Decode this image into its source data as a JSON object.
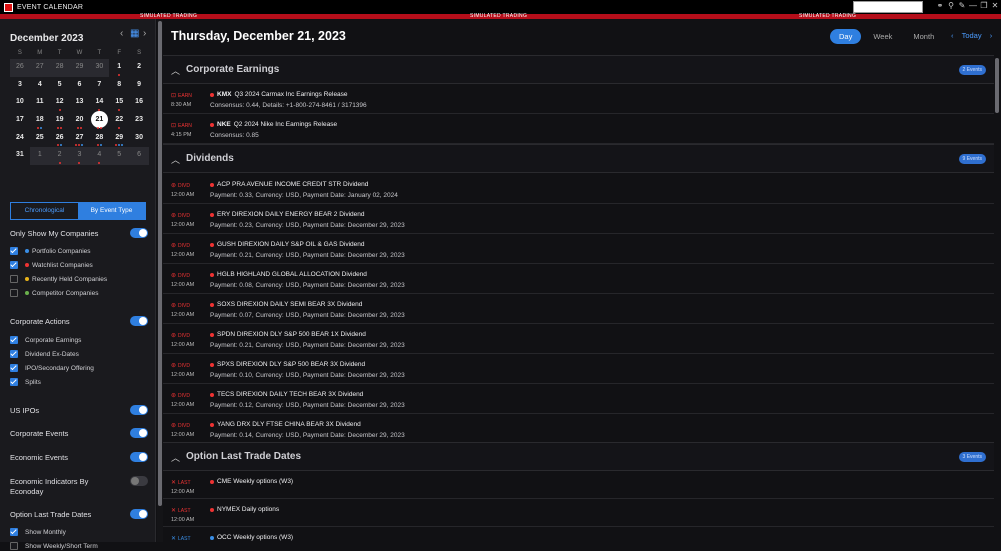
{
  "window": {
    "title": "EVENT CALENDAR",
    "banner": "SIMULATED TRADING",
    "controls": [
      "⚭",
      "⚲",
      "✎",
      "—",
      "❐",
      "✕"
    ]
  },
  "calendar": {
    "month_label": "December 2023",
    "prev": "‹",
    "next": "›",
    "cal_icon": "▦",
    "dow": [
      "S",
      "M",
      "T",
      "W",
      "T",
      "F",
      "S"
    ],
    "weeks": [
      [
        [
          "26",
          "o",
          ""
        ],
        [
          "27",
          "o",
          ""
        ],
        [
          "28",
          "o",
          ""
        ],
        [
          "29",
          "o",
          ""
        ],
        [
          "30",
          "o",
          ""
        ],
        [
          "1",
          "c",
          "r"
        ],
        [
          "2",
          "c",
          ""
        ]
      ],
      [
        [
          "3",
          "c",
          ""
        ],
        [
          "4",
          "c",
          ""
        ],
        [
          "5",
          "c",
          ""
        ],
        [
          "6",
          "c",
          ""
        ],
        [
          "7",
          "c",
          ""
        ],
        [
          "8",
          "c",
          ""
        ],
        [
          "9",
          "c",
          ""
        ]
      ],
      [
        [
          "10",
          "c",
          ""
        ],
        [
          "11",
          "c",
          ""
        ],
        [
          "12",
          "c",
          "r"
        ],
        [
          "13",
          "c",
          ""
        ],
        [
          "14",
          "c",
          "r"
        ],
        [
          "15",
          "c",
          "r"
        ],
        [
          "16",
          "c",
          ""
        ]
      ],
      [
        [
          "17",
          "c",
          ""
        ],
        [
          "18",
          "c",
          "rb"
        ],
        [
          "19",
          "c",
          "rr"
        ],
        [
          "20",
          "c",
          "rr"
        ],
        [
          "21",
          "s",
          "rr"
        ],
        [
          "22",
          "c",
          "r"
        ],
        [
          "23",
          "c",
          ""
        ]
      ],
      [
        [
          "24",
          "c",
          ""
        ],
        [
          "25",
          "c",
          ""
        ],
        [
          "26",
          "c",
          "rb"
        ],
        [
          "27",
          "c",
          "rrb"
        ],
        [
          "28",
          "c",
          "rb"
        ],
        [
          "29",
          "c",
          "rbb"
        ],
        [
          "30",
          "c",
          ""
        ]
      ],
      [
        [
          "31",
          "c",
          ""
        ],
        [
          "1",
          "o",
          ""
        ],
        [
          "2",
          "o",
          "r"
        ],
        [
          "3",
          "o",
          "r"
        ],
        [
          "4",
          "o",
          "r"
        ],
        [
          "5",
          "o",
          ""
        ],
        [
          "6",
          "o",
          ""
        ]
      ]
    ]
  },
  "segment": {
    "chronological": "Chronological",
    "by_type": "By Event Type"
  },
  "filters": {
    "only_mine": "Only Show My Companies",
    "portfolio": "Portfolio Companies",
    "watchlist": "Watchlist Companies",
    "recent": "Recently Held Companies",
    "competitor": "Competitor Companies",
    "corp_actions": "Corporate Actions",
    "corp_earnings": "Corporate Earnings",
    "dividend": "Dividend Ex-Dates",
    "ipo": "IPO/Secondary Offering",
    "splits": "Splits",
    "us_ipos": "US IPOs",
    "corp_events": "Corporate Events",
    "econ_events": "Economic Events",
    "econ_indicators": "Economic Indicators By Econoday",
    "option_last": "Option Last Trade Dates",
    "show_monthly": "Show Monthly",
    "show_weekly": "Show Weekly/Short Term"
  },
  "main": {
    "date_title": "Thursday, December 21, 2023",
    "views": {
      "day": "Day",
      "week": "Week",
      "month": "Month"
    },
    "today": "Today",
    "prev": "‹",
    "next": "›"
  },
  "sections": {
    "earnings": {
      "name": "Corporate Earnings",
      "badge": "2 Events"
    },
    "dividends": {
      "name": "Dividends",
      "badge": "9 Events"
    },
    "options": {
      "name": "Option Last Trade Dates",
      "badge": "3 Events"
    }
  },
  "events": {
    "earn1": {
      "tag": "EARN",
      "time": "8:30 AM",
      "ticker": "KMX",
      "title": "Q3 2024 Carmax Inc Earnings Release",
      "details": "Consensus: 0.44, Details: +1-800-274-8461 / 3171396"
    },
    "earn2": {
      "tag": "EARN",
      "time": "4:15 PM",
      "ticker": "NKE",
      "title": "Q2 2024 Nike Inc Earnings Release",
      "details": "Consensus: 0.85"
    },
    "div": [
      {
        "tag": "DIVD",
        "time": "12:00 AM",
        "title": "ACP PRA AVENUE INCOME CREDIT STR Dividend",
        "details": "Payment: 0.33, Currency: USD, Payment Date: January 02, 2024"
      },
      {
        "tag": "DIVD",
        "time": "12:00 AM",
        "title": "ERY DIREXION DAILY ENERGY BEAR 2 Dividend",
        "details": "Payment: 0.23, Currency: USD, Payment Date: December 29, 2023"
      },
      {
        "tag": "DIVD",
        "time": "12:00 AM",
        "title": "GUSH DIREXION DAILY S&P OIL & GAS Dividend",
        "details": "Payment: 0.21, Currency: USD, Payment Date: December 29, 2023"
      },
      {
        "tag": "DIVD",
        "time": "12:00 AM",
        "title": "HGLB HIGHLAND GLOBAL ALLOCATION Dividend",
        "details": "Payment: 0.08, Currency: USD, Payment Date: December 29, 2023"
      },
      {
        "tag": "DIVD",
        "time": "12:00 AM",
        "title": "SOXS DIREXION DAILY SEMI BEAR 3X Dividend",
        "details": "Payment: 0.07, Currency: USD, Payment Date: December 29, 2023"
      },
      {
        "tag": "DIVD",
        "time": "12:00 AM",
        "title": "SPDN DIREXION DLY S&P 500 BEAR 1X Dividend",
        "details": "Payment: 0.21, Currency: USD, Payment Date: December 29, 2023"
      },
      {
        "tag": "DIVD",
        "time": "12:00 AM",
        "title": "SPXS DIREXION DLY S&P 500 BEAR 3X Dividend",
        "details": "Payment: 0.10, Currency: USD, Payment Date: December 29, 2023"
      },
      {
        "tag": "DIVD",
        "time": "12:00 AM",
        "title": "TECS DIREXION DAILY TECH BEAR 3X Dividend",
        "details": "Payment: 0.12, Currency: USD, Payment Date: December 29, 2023"
      },
      {
        "tag": "DIVD",
        "time": "12:00 AM",
        "title": "YANG DRX DLY FTSE CHINA BEAR 3X Dividend",
        "details": "Payment: 0.14, Currency: USD, Payment Date: December 29, 2023"
      }
    ],
    "opt1": {
      "tag": "LAST",
      "time": "12:00 AM",
      "title": "CME Weekly options (W3)"
    },
    "opt2": {
      "tag": "LAST",
      "time": "12:00 AM",
      "title": "NYMEX Daily options"
    },
    "opt3": {
      "tag": "LAST",
      "title": "OCC Weekly options (W3)"
    }
  },
  "colors": {
    "accent": "#2f7fe0",
    "banner": "#b50e1a",
    "event_red": "#e33333",
    "event_blue": "#3a8ee6"
  }
}
